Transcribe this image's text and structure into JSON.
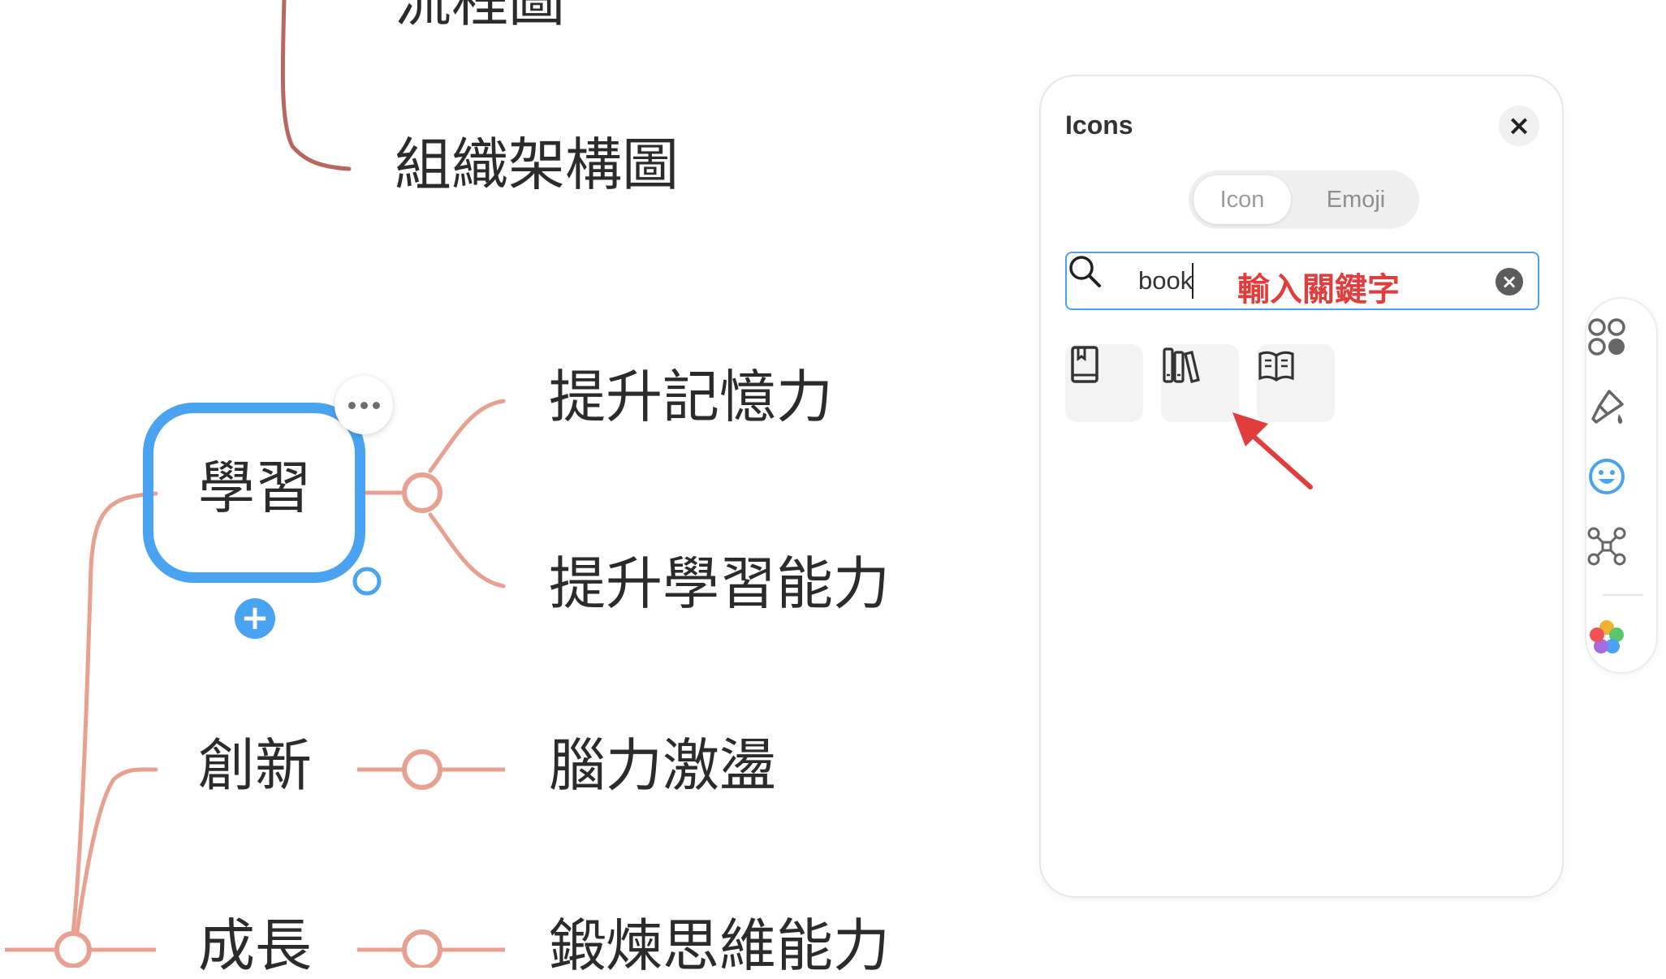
{
  "mindmap": {
    "nodes": {
      "top_partial": "流程圖",
      "org_chart": "組織架構圖",
      "learning": "學習",
      "memory": "提升記憶力",
      "learning_ability": "提升學習能力",
      "innovation": "創新",
      "brainstorm": "腦力激盪",
      "growth": "成長",
      "thinking": "鍛煉思維能力"
    },
    "colors": {
      "branch_line": "#e8a090",
      "top_line": "#b9675c",
      "selection": "#4aa3f0"
    }
  },
  "icons_panel": {
    "title": "Icons",
    "close_label": "×",
    "tabs": [
      "Icon",
      "Emoji"
    ],
    "active_tab": "Icon",
    "search": {
      "value": "book",
      "hint": "輸入關鍵字",
      "clear_label": "×"
    },
    "results": [
      "book-icon",
      "books-icon",
      "open-book-icon"
    ],
    "annotation_color": "#e23d3d"
  },
  "toolbar": {
    "items": [
      "elements-icon",
      "style-brush-icon",
      "icon-emoji-icon",
      "structure-icon",
      "theme-color-icon"
    ],
    "active": "icon-emoji-icon"
  }
}
